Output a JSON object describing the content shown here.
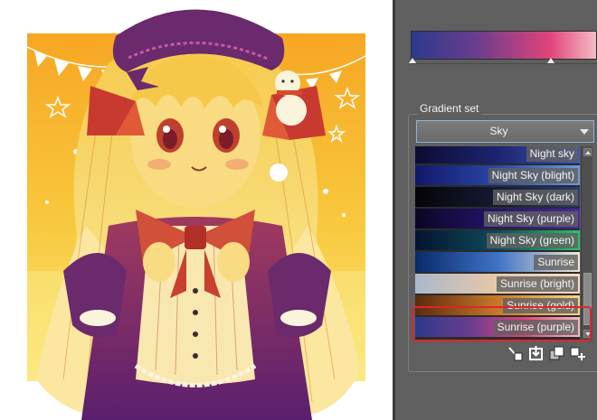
{
  "panel": {
    "gradient_set_label": "Gradient set",
    "selected_set": "Sky",
    "preview_stops": [
      {
        "position": 0.0,
        "color": "#2c3a8c"
      },
      {
        "position": 0.35,
        "color": "#6a3d8e"
      },
      {
        "position": 0.75,
        "color": "#e0447a"
      },
      {
        "position": 1.0,
        "color": "#f4bcc4"
      }
    ],
    "gradients": [
      {
        "name": "Night sky",
        "colors": [
          "#0c0c32",
          "#1c2470",
          "#3a5ab2"
        ],
        "selected": false
      },
      {
        "name": "Night Sky (blight)",
        "colors": [
          "#12186a",
          "#2a46a6",
          "#6f9ad8"
        ],
        "selected": false
      },
      {
        "name": "Night Sky (dark)",
        "colors": [
          "#050508",
          "#141a34",
          "#2c3e6e"
        ],
        "selected": false
      },
      {
        "name": "Night Sky (purple)",
        "colors": [
          "#0a0626",
          "#26146a",
          "#4a2aa0"
        ],
        "selected": false
      },
      {
        "name": "Night Sky (green)",
        "colors": [
          "#061430",
          "#0e4a5a",
          "#2cc46c"
        ],
        "selected": false
      },
      {
        "name": "Sunrise",
        "colors": [
          "#082a6a",
          "#3f72c6",
          "#f2e8d4"
        ],
        "selected": false
      },
      {
        "name": "Sunrise (bright)",
        "colors": [
          "#aab8cc",
          "#e8c8a8",
          "#f6dcbe"
        ],
        "selected": false
      },
      {
        "name": "Sunrise (gold)",
        "colors": [
          "#5c2a0c",
          "#c8782a",
          "#f6d888"
        ],
        "selected": false
      },
      {
        "name": "Sunrise (purple)",
        "colors": [
          "#2c3a8c",
          "#6a3d8e",
          "#e0447a",
          "#f4bcc4"
        ],
        "selected": true
      }
    ]
  },
  "toolbar": {
    "icons": [
      "add-gradient-icon",
      "import-gradient-icon",
      "duplicate-gradient-icon",
      "new-gradient-icon"
    ]
  },
  "colors": {
    "panel_bg": "#5f5f5f",
    "selection_border": "#e0242c",
    "select_border": "#8fb2d6",
    "artwork_background": "#f7a623"
  }
}
